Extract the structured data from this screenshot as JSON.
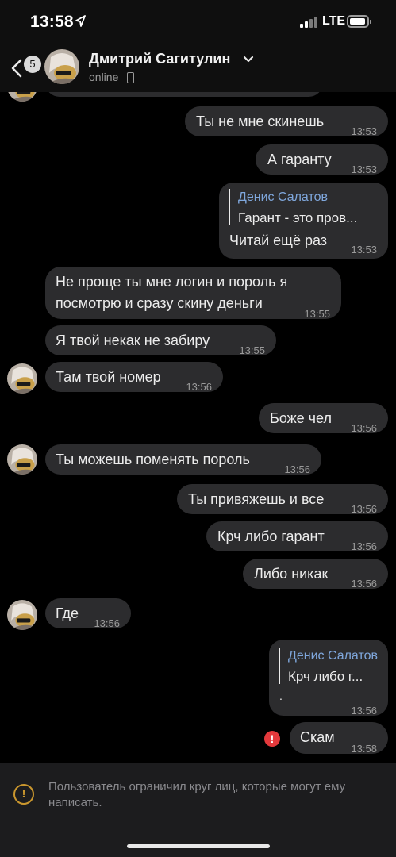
{
  "status_bar": {
    "time": "13:58",
    "network": "LTE"
  },
  "header": {
    "back_count": "5",
    "contact_name": "Дмитрий Сагитулин",
    "status": "online"
  },
  "messages": [
    {
      "side": "out",
      "text": "Ты не мне скинешь",
      "time": "13:53"
    },
    {
      "side": "out",
      "text": "А гаранту",
      "time": "13:53"
    },
    {
      "side": "out",
      "reply_name": "Денис Салатов",
      "reply_text": "Гарант - это пров...",
      "text": "Читай ещё раз",
      "time": "13:53"
    },
    {
      "side": "in",
      "lines": [
        "Не проще ты мне логин и пороль я",
        "посмотрю и сразу скину деньги"
      ],
      "time": "13:55"
    },
    {
      "side": "in",
      "text": "Я твой некак не забиру",
      "time": "13:55"
    },
    {
      "side": "in",
      "text": "Там твой номер",
      "time": "13:56"
    },
    {
      "side": "out",
      "text": "Боже чел",
      "time": "13:56"
    },
    {
      "side": "in",
      "text": "Ты можешь поменять пороль",
      "time": "13:56"
    },
    {
      "side": "out",
      "text": "Ты привяжешь и все",
      "time": "13:56"
    },
    {
      "side": "out",
      "text": "Крч либо гарант",
      "time": "13:56"
    },
    {
      "side": "out",
      "text": "Либо никак",
      "time": "13:56"
    },
    {
      "side": "in",
      "text": "Где",
      "time": "13:56"
    },
    {
      "side": "out",
      "reply_name": "Денис Салатов",
      "reply_text": "Крч либо г...",
      "text": ".",
      "time": "13:56"
    },
    {
      "side": "out",
      "text": "Скам",
      "time": "13:58",
      "error": true
    }
  ],
  "icons": {
    "back": "chevron-left-icon",
    "location": "location-arrow-icon",
    "dropdown": "chevron-down-icon",
    "device": "phone-icon",
    "error": "exclamation-icon",
    "warning": "warning-icon"
  },
  "colors": {
    "reply_name": "#7fa7dc",
    "error": "#e3393c",
    "warning": "#c9962e"
  },
  "notice": {
    "icon_glyph": "!",
    "text": "Пользователь ограничил круг лиц, которые могут ему написать."
  }
}
